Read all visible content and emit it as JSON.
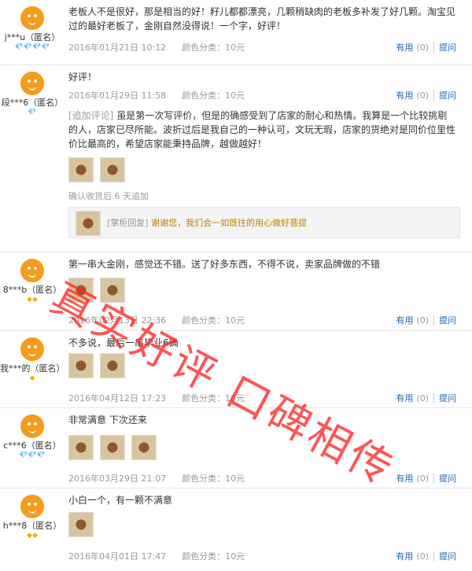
{
  "reviews": [
    {
      "user": "j***u（匿名）",
      "rank": "💎💎💎💎",
      "text": "老板人不是很好，那是相当的好！籽儿都都漂亮，几颗稍缺肉的老板多补发了好几颗。淘宝见过的最好老板了，金刚自然没得说！一个字，好评！",
      "date": "2016年01月21日 10:12",
      "color": "颜色分类：10元",
      "useful": "有用",
      "count": "(0)",
      "ask": "提问"
    },
    {
      "user": "段***6（匿名）",
      "rank": "💎",
      "text": "好评！",
      "date": "2016年01月29日 11:58",
      "color": "颜色分类：10元",
      "useful": "有用",
      "count": "(0)",
      "ask": "提问",
      "add_tag": "[追加评论]",
      "add_text": "虽是第一次写评价，但是的确感受到了店家的耐心和热情。我算是一个比较挑剔的人，店家已尽所能。波折过后是我自己的一种认可，文玩无瑕，店家的货绝对是同价位里性价比最高的，希望店家能秉持品牌，越做越好！",
      "add_note": "确认收货后 6 天追加",
      "reply_tag": "[掌柜回复]",
      "reply_text": "谢谢您，我们会一如既往的用心做好菩提"
    },
    {
      "user": "8***b（匿名）",
      "rank": "◆◆",
      "text": "第一串大金刚，感觉还不错。送了好多东西，不得不说，卖家品牌做的不错",
      "date": "2016年02月13日 22:36",
      "color": "颜色分类：10元",
      "useful": "有用",
      "count": "(0)",
      "ask": "提问"
    },
    {
      "user": "我***的（匿名）",
      "rank": "◆",
      "text": "不多说，最后一串毕业6确",
      "date": "2016年04月12日 17:23",
      "color": "颜色分类：10元",
      "useful": "有用",
      "count": "(0)",
      "ask": "提问"
    },
    {
      "user": "c***6（匿名）",
      "rank": "💎💎💎",
      "text": "非常满意 下次还来",
      "date": "2016年03月29日 21:07",
      "color": "颜色分类：10元",
      "useful": "有用",
      "count": "(0)",
      "ask": "提问"
    },
    {
      "user": "h***8（匿名）",
      "rank": "◆◆",
      "text": "小白一个，有一颗不满意",
      "date": "2016年04月01日 17:47",
      "color": "颜色分类：10元",
      "useful": "有用",
      "count": "(0)",
      "ask": "提问"
    }
  ],
  "watermark": "真实好评 口碑相传"
}
